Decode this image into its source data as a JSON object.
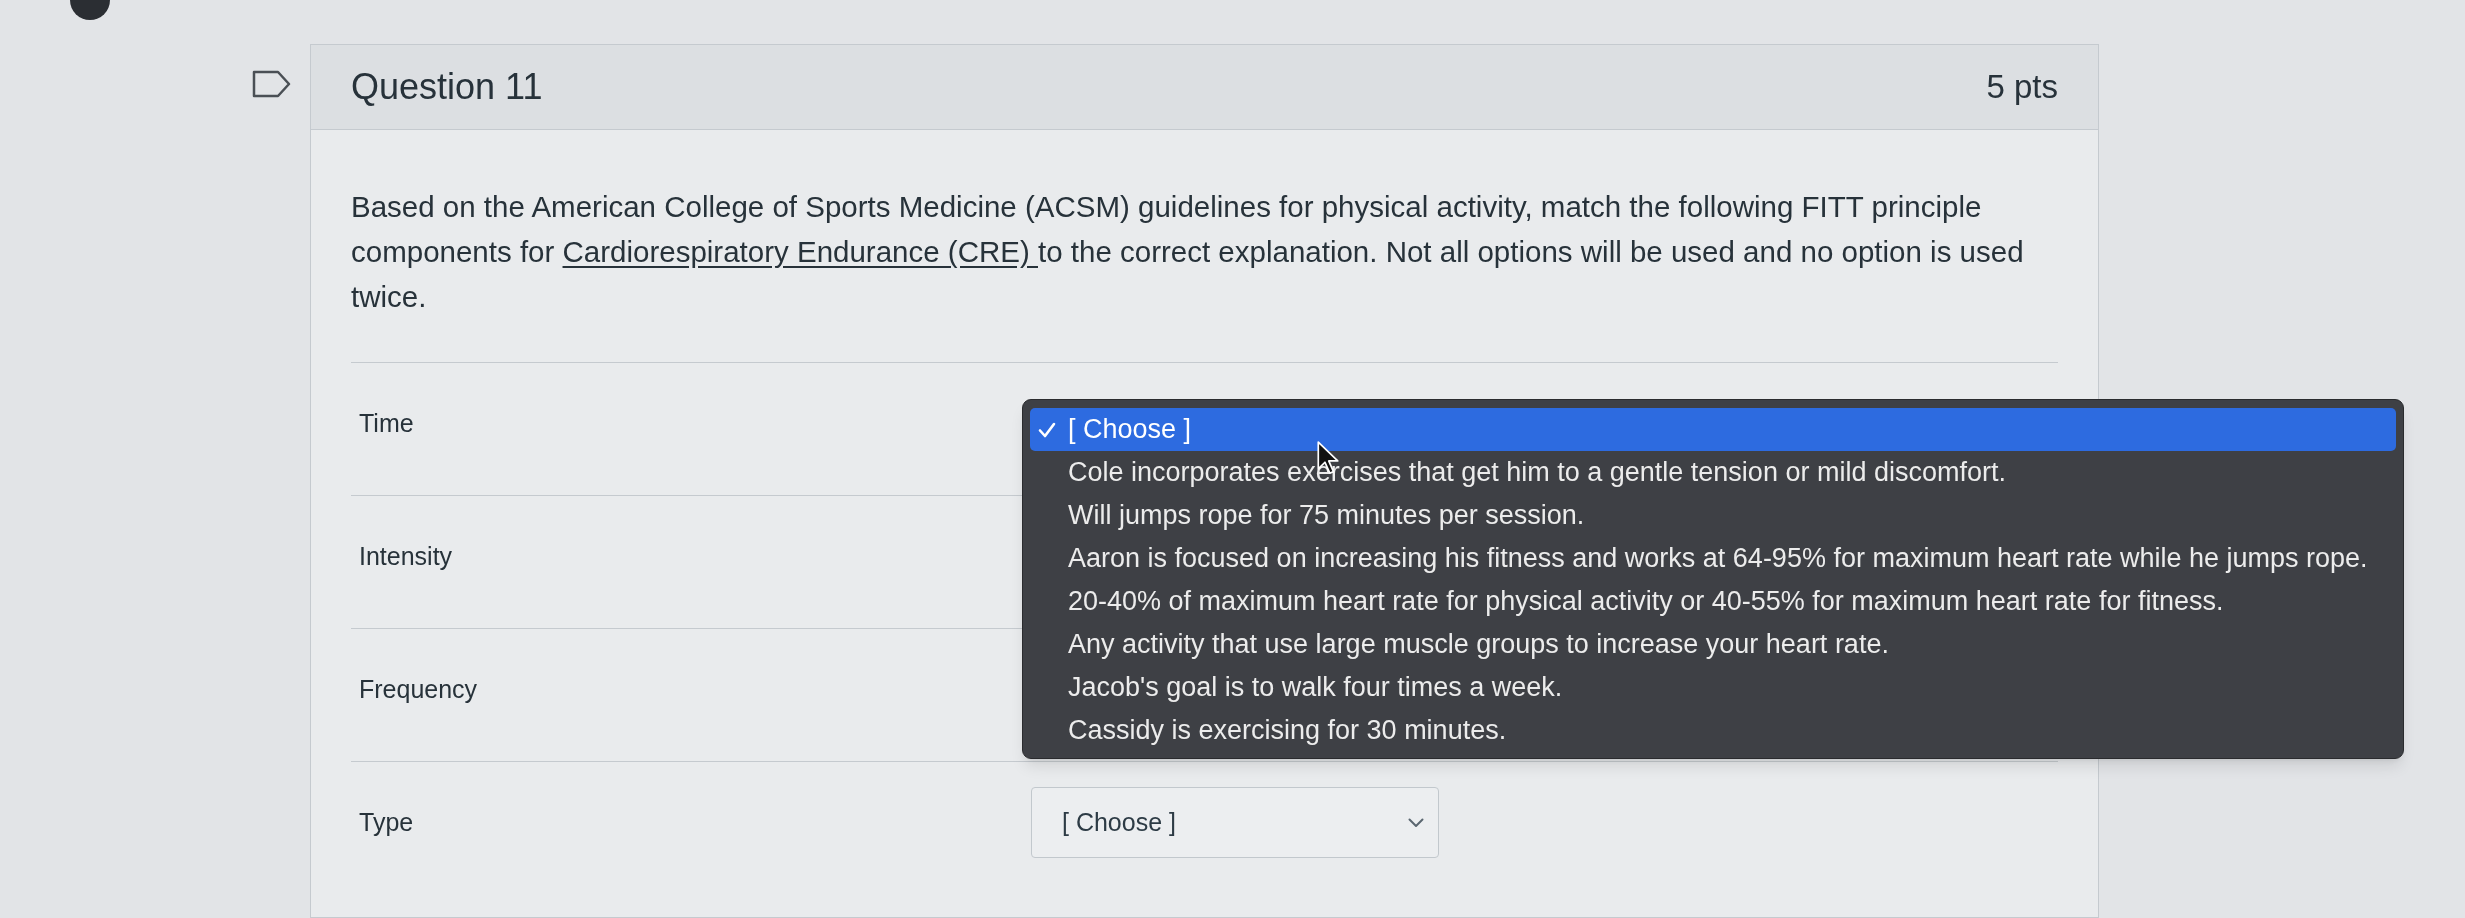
{
  "question": {
    "title": "Question 11",
    "points": "5 pts"
  },
  "prompt": [
    {
      "text": "Based on the American College of Sports Medicine (ACSM) guidelines for physical activity, match the following FITT principle components for ",
      "underline": false
    },
    {
      "text": "Cardiorespiratory Endurance (CRE) ",
      "underline": true
    },
    {
      "text": "to the correct explanation. Not all options will be used and no option is used twice.",
      "underline": false
    }
  ],
  "matches": [
    {
      "label": "Time",
      "expanded": true,
      "options": [
        {
          "text": "[ Choose ]",
          "selected": true
        },
        {
          "text": "Cole incorporates exercises that get him to a gentle tension or mild discomfort.",
          "selected": false
        },
        {
          "text": "Will jumps rope for 75 minutes per session.",
          "selected": false
        },
        {
          "text": "Aaron is focused on increasing his fitness and works at 64-95% for maximum heart rate while he jumps rope.",
          "selected": false
        },
        {
          "text": "20-40% of maximum heart rate for physical activity or 40-55% for maximum heart rate for fitness.",
          "selected": false
        },
        {
          "text": "Any activity that use large muscle groups to increase your heart rate.",
          "selected": false
        },
        {
          "text": "Jacob's goal is to walk four times a week.",
          "selected": false
        },
        {
          "text": "Cassidy is exercising for 30 minutes.",
          "selected": false
        }
      ]
    },
    {
      "label": "Intensity"
    },
    {
      "label": "Frequency"
    },
    {
      "label": "Type",
      "expanded": false,
      "value": "[ Choose ]"
    }
  ]
}
